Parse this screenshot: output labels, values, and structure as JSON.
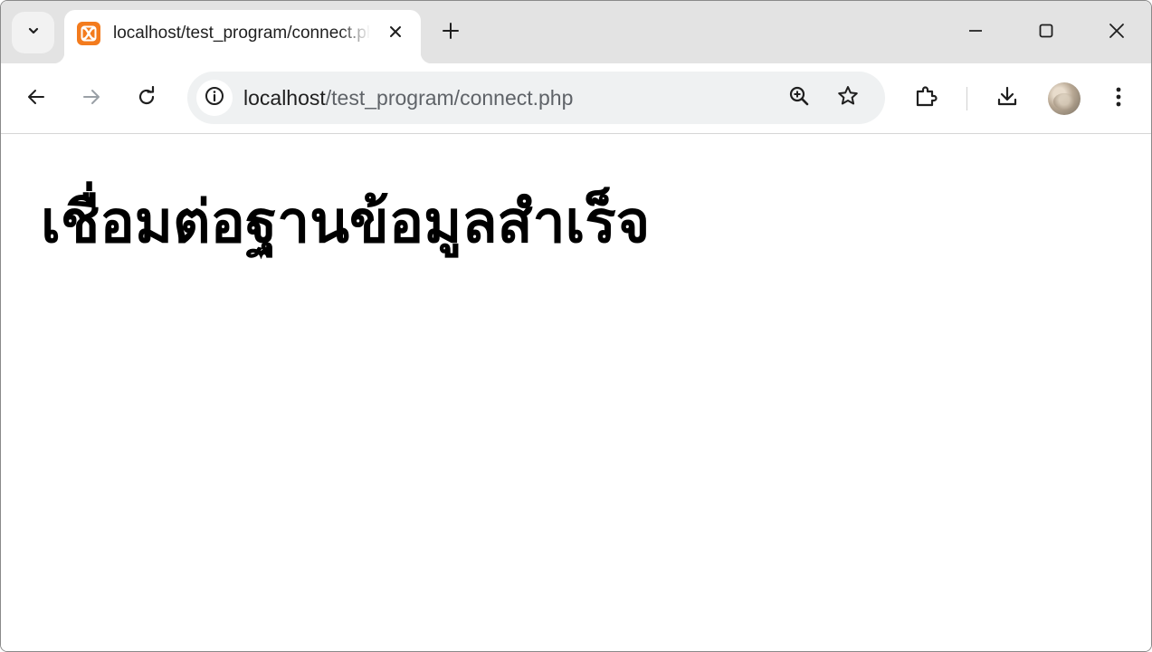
{
  "tab": {
    "title": "localhost/test_program/connect.php",
    "favicon": "xampp-icon"
  },
  "omnibox": {
    "url_host": "localhost",
    "url_path": "/test_program/connect.php"
  },
  "page": {
    "heading": "เชื่อมต่อฐานข้อมูลสำเร็จ"
  },
  "colors": {
    "tabstrip": "#e3e3e3",
    "omnibox": "#eff1f2",
    "favicon": "#f37b1d",
    "text": "#1f1f1f"
  },
  "icons": [
    "tab-search-icon",
    "xampp-icon",
    "close-icon",
    "new-tab-icon",
    "minimize-icon",
    "maximize-icon",
    "window-close-icon",
    "back-icon",
    "forward-icon",
    "reload-icon",
    "info-icon",
    "zoom-icon",
    "bookmark-star-icon",
    "extensions-icon",
    "download-icon",
    "profile-avatar",
    "more-menu-icon"
  ]
}
